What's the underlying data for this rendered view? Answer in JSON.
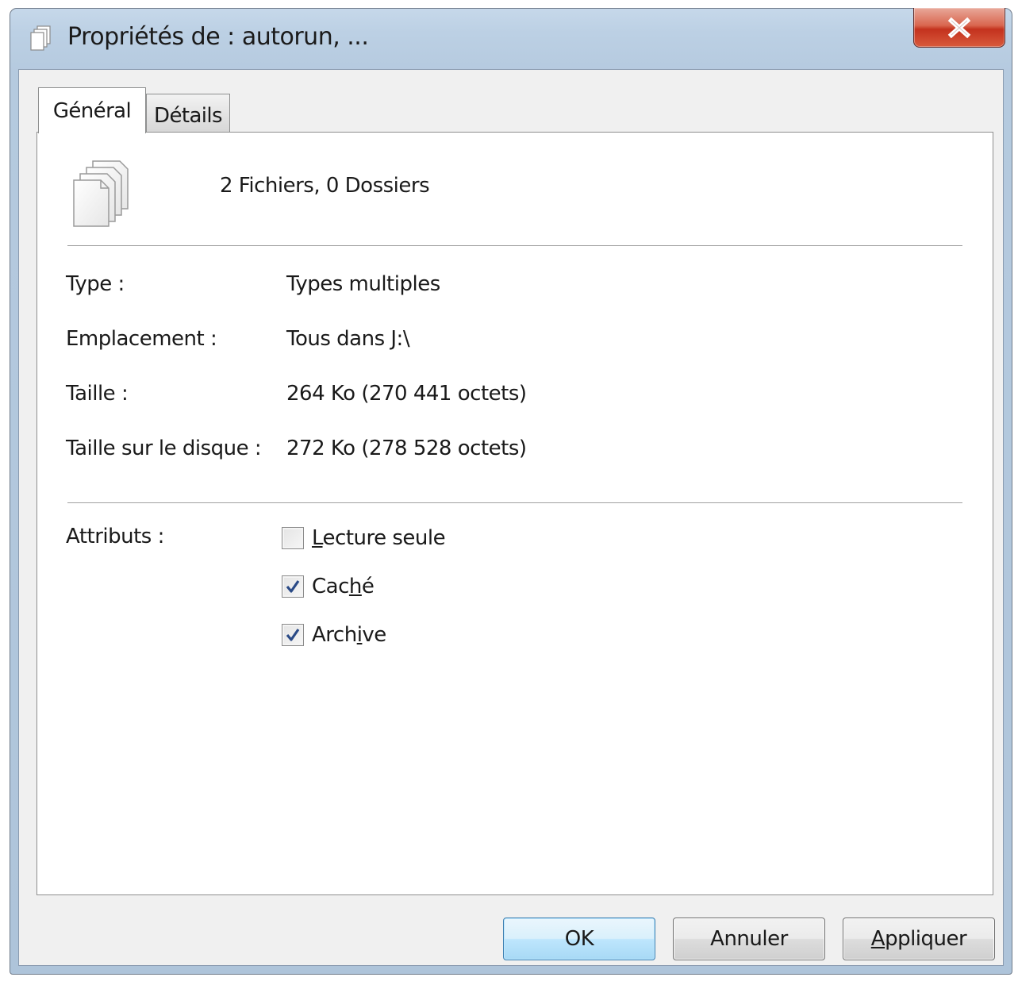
{
  "window": {
    "title": "Propriétés de : autorun, ...",
    "close_symbol": "X"
  },
  "tabs": [
    {
      "label": "Général",
      "selected": true
    },
    {
      "label": "Détails",
      "selected": false
    }
  ],
  "summary": "2 Fichiers, 0 Dossiers",
  "properties": {
    "type_label": "Type :",
    "type_value": "Types multiples",
    "location_label": "Emplacement :",
    "location_value": "Tous dans J:\\",
    "size_label": "Taille :",
    "size_value": "264 Ko (270 441 octets)",
    "disk_size_label": "Taille sur le disque :",
    "disk_size_value": "272 Ko (278 528 octets)"
  },
  "attributes": {
    "label": "Attributs :",
    "read_only": {
      "pre": "",
      "accel": "L",
      "post": "ecture seule",
      "checked": false
    },
    "hidden": {
      "pre": "Cac",
      "accel": "h",
      "post": "é",
      "checked": true
    },
    "archive": {
      "pre": "Arch",
      "accel": "i",
      "post": "ve",
      "checked": true
    }
  },
  "buttons": {
    "ok": "OK",
    "cancel": "Annuler",
    "apply_accel": "A",
    "apply_rest": "ppliquer"
  },
  "icons": {
    "title": "multiple-files-icon",
    "summary": "multiple-files-icon",
    "close": "close-icon",
    "check": "checkmark-icon"
  },
  "colors": {
    "titlebar": "#bcd0e4",
    "close_button": "#c4321e",
    "checkmark": "#2a4a86",
    "default_button_border": "#3c7fb1"
  }
}
